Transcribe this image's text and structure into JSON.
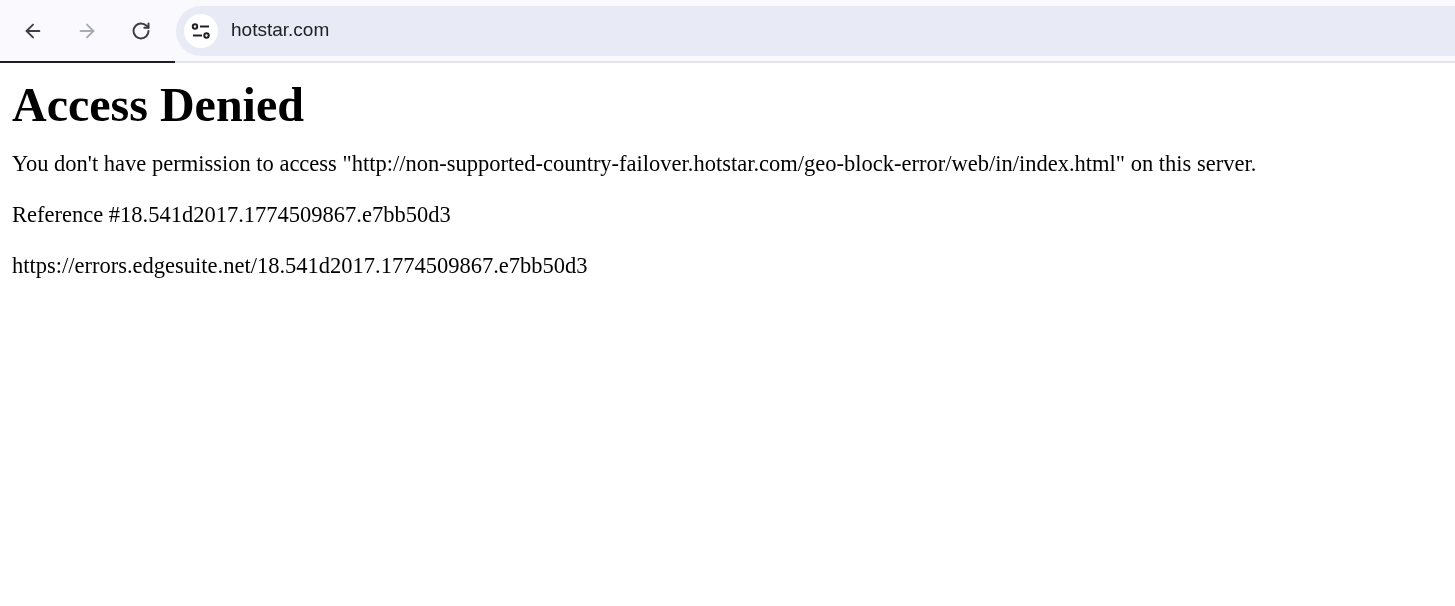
{
  "toolbar": {
    "back": {
      "disabled": false
    },
    "forward": {
      "disabled": true
    },
    "address": "hotstar.com",
    "load_progress": {
      "level": 0.12
    }
  },
  "page": {
    "heading": "Access Denied",
    "paragraphs": [
      "You don't have permission to access \"http://non-supported-country-failover.hotstar.com/geo-block-error/web/in/index.html\" on this server.",
      "Reference #18.541d2017.1774509867.e7bb50d3",
      "https://errors.edgesuite.net/18.541d2017.1774509867.e7bb50d3"
    ]
  }
}
